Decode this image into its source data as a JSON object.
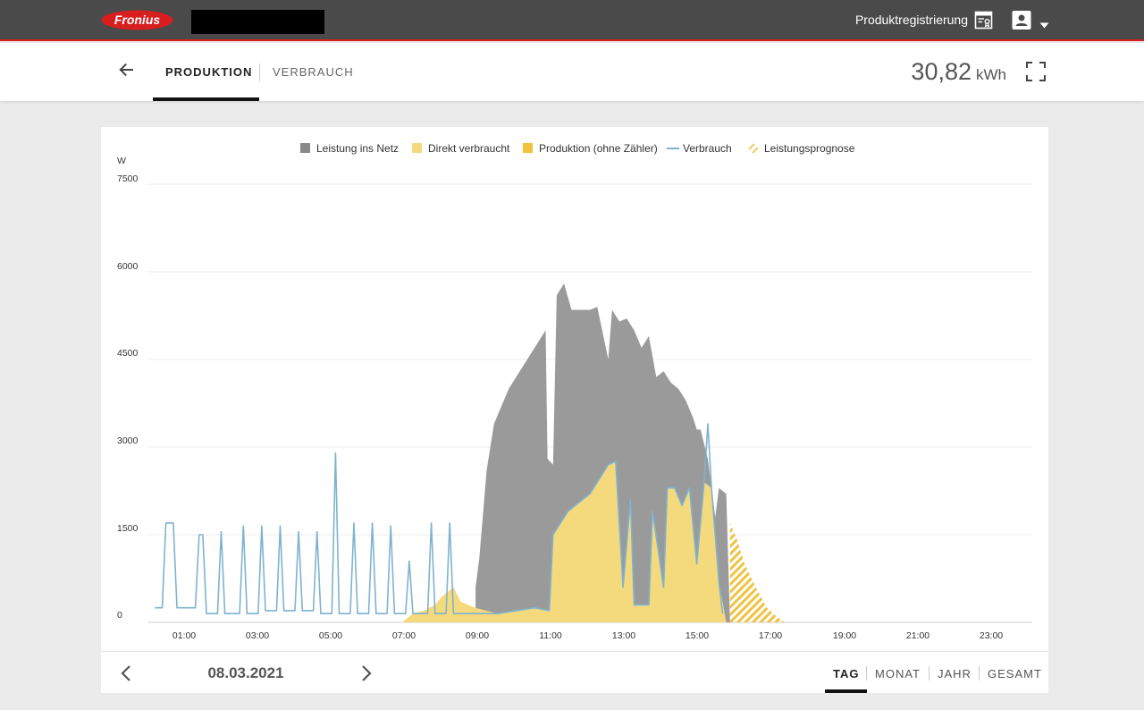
{
  "header": {
    "logo_text": "Fronius",
    "product_registration_label": "Produktregistrierung",
    "icons": [
      "registration-document-icon",
      "user-icon",
      "caret-down-icon"
    ],
    "colors": {
      "bar": "#4a4a4a",
      "accent": "#d81e1e"
    }
  },
  "tabs": {
    "production": "PRODUKTION",
    "consumption": "VERBRAUCH",
    "active": "PRODUKTION"
  },
  "energy": {
    "value": "30,82",
    "unit": "kWh"
  },
  "chart_data": {
    "type": "area",
    "legend": [
      {
        "label": "Leistung ins Netz",
        "color": "#9a9a9a",
        "style": "area"
      },
      {
        "label": "Direkt verbraucht",
        "color": "#f5d97d",
        "style": "area"
      },
      {
        "label": "Produktion (ohne Zähler)",
        "color": "#f0c23e",
        "style": "area"
      },
      {
        "label": "Verbrauch",
        "color": "#7fb3cf",
        "style": "line"
      },
      {
        "label": "Leistungsprognose",
        "color": "#f0c23e",
        "style": "hatched-area"
      }
    ],
    "y_unit": "W",
    "y_ticks": [
      "0",
      "1500",
      "3000",
      "4500",
      "6000",
      "7500"
    ],
    "ylim": [
      0,
      7500
    ],
    "x_ticks": [
      "01:00",
      "03:00",
      "05:00",
      "07:00",
      "09:00",
      "11:00",
      "13:00",
      "15:00",
      "17:00",
      "19:00",
      "21:00",
      "23:00"
    ],
    "xlim_hours": [
      0,
      24
    ],
    "grid": true,
    "legend_position": "top-center",
    "series": [
      {
        "name": "Leistung ins Netz",
        "points": [
          [
            8.9,
            600
          ],
          [
            9.0,
            1100
          ],
          [
            9.2,
            2600
          ],
          [
            9.4,
            3400
          ],
          [
            9.6,
            3700
          ],
          [
            9.8,
            4000
          ],
          [
            10.0,
            4200
          ],
          [
            10.4,
            4600
          ],
          [
            10.6,
            4800
          ],
          [
            10.8,
            5000
          ],
          [
            10.85,
            2800
          ],
          [
            11.0,
            2700
          ],
          [
            11.1,
            5600
          ],
          [
            11.3,
            5800
          ],
          [
            11.5,
            5350
          ],
          [
            12.0,
            5350
          ],
          [
            12.2,
            5400
          ],
          [
            12.5,
            4500
          ],
          [
            12.6,
            5350
          ],
          [
            12.8,
            5150
          ],
          [
            13.0,
            5200
          ],
          [
            13.2,
            5000
          ],
          [
            13.4,
            4700
          ],
          [
            13.6,
            4900
          ],
          [
            13.8,
            4200
          ],
          [
            14.0,
            4300
          ],
          [
            14.2,
            4100
          ],
          [
            14.4,
            4000
          ],
          [
            14.6,
            3800
          ],
          [
            14.8,
            3500
          ],
          [
            14.9,
            3300
          ],
          [
            15.0,
            3300
          ],
          [
            15.2,
            2800
          ],
          [
            15.4,
            1800
          ],
          [
            15.5,
            2300
          ],
          [
            15.7,
            2200
          ],
          [
            15.8,
            0
          ]
        ]
      },
      {
        "name": "Direkt verbraucht",
        "points": [
          [
            6.9,
            0
          ],
          [
            7.2,
            150
          ],
          [
            7.5,
            200
          ],
          [
            7.8,
            300
          ],
          [
            8.0,
            450
          ],
          [
            8.3,
            600
          ],
          [
            8.5,
            350
          ],
          [
            8.7,
            300
          ],
          [
            8.9,
            250
          ],
          [
            9.5,
            150
          ],
          [
            10.0,
            200
          ],
          [
            10.5,
            250
          ],
          [
            10.9,
            200
          ],
          [
            11.0,
            1500
          ],
          [
            11.4,
            1900
          ],
          [
            11.8,
            2100
          ],
          [
            12.0,
            2200
          ],
          [
            12.3,
            2500
          ],
          [
            12.5,
            2700
          ],
          [
            12.7,
            2750
          ],
          [
            12.9,
            600
          ],
          [
            13.1,
            2100
          ],
          [
            13.2,
            300
          ],
          [
            13.6,
            300
          ],
          [
            13.7,
            1900
          ],
          [
            14.0,
            600
          ],
          [
            14.1,
            2300
          ],
          [
            14.3,
            2300
          ],
          [
            14.5,
            2000
          ],
          [
            14.7,
            2300
          ],
          [
            14.9,
            1000
          ],
          [
            15.1,
            2400
          ],
          [
            15.3,
            2300
          ],
          [
            15.5,
            700
          ],
          [
            15.7,
            0
          ]
        ]
      },
      {
        "name": "Verbrauch",
        "points": [
          [
            0.2,
            250
          ],
          [
            0.4,
            250
          ],
          [
            0.5,
            1700
          ],
          [
            0.7,
            1700
          ],
          [
            0.8,
            250
          ],
          [
            1.3,
            250
          ],
          [
            1.4,
            1500
          ],
          [
            1.5,
            1500
          ],
          [
            1.6,
            150
          ],
          [
            1.9,
            150
          ],
          [
            2.0,
            1550
          ],
          [
            2.1,
            150
          ],
          [
            2.5,
            150
          ],
          [
            2.6,
            1650
          ],
          [
            2.7,
            150
          ],
          [
            3.0,
            150
          ],
          [
            3.1,
            1650
          ],
          [
            3.2,
            200
          ],
          [
            3.5,
            200
          ],
          [
            3.6,
            1650
          ],
          [
            3.7,
            200
          ],
          [
            4.0,
            200
          ],
          [
            4.1,
            1550
          ],
          [
            4.2,
            200
          ],
          [
            4.5,
            200
          ],
          [
            4.6,
            1550
          ],
          [
            4.7,
            150
          ],
          [
            5.0,
            150
          ],
          [
            5.1,
            2900
          ],
          [
            5.2,
            150
          ],
          [
            5.5,
            150
          ],
          [
            5.6,
            1700
          ],
          [
            5.7,
            150
          ],
          [
            6.0,
            150
          ],
          [
            6.1,
            1700
          ],
          [
            6.2,
            150
          ],
          [
            6.5,
            150
          ],
          [
            6.6,
            1650
          ],
          [
            6.7,
            150
          ],
          [
            7.0,
            150
          ],
          [
            7.1,
            1050
          ],
          [
            7.2,
            150
          ],
          [
            7.6,
            150
          ],
          [
            7.7,
            1700
          ],
          [
            7.8,
            150
          ],
          [
            8.1,
            150
          ],
          [
            8.2,
            1700
          ],
          [
            8.3,
            150
          ],
          [
            9.5,
            150
          ],
          [
            10.0,
            200
          ],
          [
            10.5,
            250
          ],
          [
            10.9,
            200
          ],
          [
            11.0,
            1500
          ],
          [
            11.4,
            1900
          ],
          [
            11.8,
            2100
          ],
          [
            12.0,
            2200
          ],
          [
            12.3,
            2500
          ],
          [
            12.5,
            2700
          ],
          [
            12.7,
            2750
          ],
          [
            12.9,
            600
          ],
          [
            13.1,
            2100
          ],
          [
            13.2,
            300
          ],
          [
            13.6,
            300
          ],
          [
            13.7,
            1900
          ],
          [
            14.0,
            600
          ],
          [
            14.1,
            2300
          ],
          [
            14.3,
            2300
          ],
          [
            14.5,
            2000
          ],
          [
            14.7,
            2300
          ],
          [
            14.9,
            1000
          ],
          [
            15.1,
            2400
          ],
          [
            15.2,
            3400
          ],
          [
            15.3,
            2300
          ],
          [
            15.5,
            700
          ],
          [
            15.6,
            150
          ]
        ]
      },
      {
        "name": "Leistungsprognose",
        "points": [
          [
            15.8,
            1700
          ],
          [
            16.0,
            1400
          ],
          [
            16.2,
            1000
          ],
          [
            16.5,
            600
          ],
          [
            16.8,
            250
          ],
          [
            17.1,
            80
          ],
          [
            17.3,
            0
          ]
        ]
      }
    ]
  },
  "footer": {
    "date": "08.03.2021",
    "periods": [
      "TAG",
      "MONAT",
      "JAHR",
      "GESAMT"
    ],
    "active_period": "TAG"
  }
}
